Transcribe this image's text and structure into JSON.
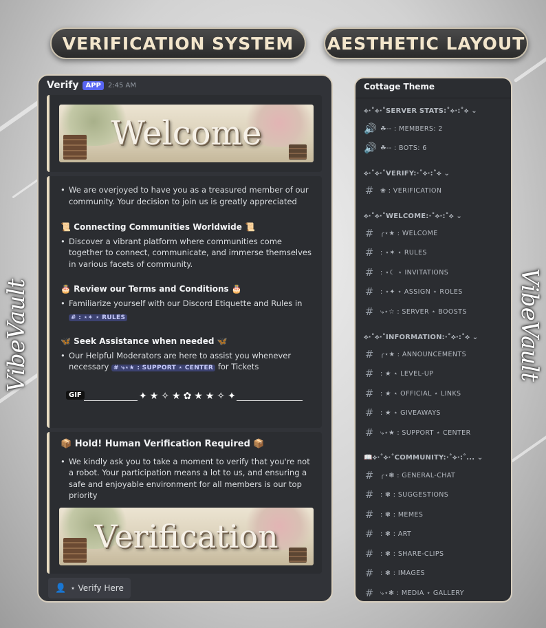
{
  "titles": {
    "left": "VERIFICATION SYSTEM",
    "right": "AESTHETIC LAYOUT"
  },
  "side_brand": "VibeVault",
  "message": {
    "author": "Verify",
    "badge": "APP",
    "time": "2:45 AM",
    "banner_welcome": "Welcome",
    "intro": "We are overjoyed to have you as a treasured member of our community. Your decision to join us is greatly appreciated",
    "sections": [
      {
        "heading": "Connecting Communities Worldwide",
        "text": "Discover a vibrant platform where communities come together to connect, communicate, and immerse themselves in various facets of community."
      },
      {
        "heading": "Review our Terms and Conditions",
        "text": "Familiarize yourself with our Discord Etiquette and Rules in"
      },
      {
        "heading": "Seek Assistance when needed",
        "text_before": "Our Helpful Moderators are here to assist you whenever necessary",
        "text_after": "for Tickets"
      }
    ],
    "mention_rules": "# : ⋆✶ ⋆ RULES",
    "mention_support": "# ⤷⋆★ : SUPPORT ⋆ CENTER",
    "gif_label": "GIF",
    "hold_heading": "Hold!  Human Verification Required",
    "hold_text": "We kindly ask you to take a moment to verify that you're not a robot. Your participation means a lot to us, and ensuring a safe and enjoyable environment for all members is our top priority",
    "banner_verification": "Verification",
    "button_label": "⋆ Verify Here"
  },
  "server": {
    "name": "Cottage Theme",
    "categories": [
      {
        "label": "⟡·˚⟡·˚SERVER STATS:˚⟡·:˚⟡ ⌄",
        "channels": [
          {
            "icon": "speaker-icon",
            "label": "☘︎-- : MEMBERS: 2"
          },
          {
            "icon": "speaker-icon",
            "label": "☘︎-- : BOTS: 6"
          }
        ]
      },
      {
        "label": "⟡·˚⟡·˚VERIFY:·˚⟡·:˚⟡ ⌄",
        "channels": [
          {
            "icon": "hash-icon",
            "label": "❀ : VERIFICATION"
          }
        ]
      },
      {
        "label": "⟡·˚⟡·˚WELCOME:·˚⟡·:˚⟡ ⌄",
        "channels": [
          {
            "icon": "hash-icon",
            "label": "╭⋆★ : WELCOME"
          },
          {
            "icon": "hash-icon",
            "label": ": ⋆✶ ⋆ RULES"
          },
          {
            "icon": "hash-icon",
            "label": ": ⋆☾ ⋆ INVITATIONS"
          },
          {
            "icon": "hash-icon",
            "label": ": ⋆✦ ⋆ ASSIGN ⋆ ROLES"
          },
          {
            "icon": "hash-icon",
            "label": "⤷⋆☆ : SERVER ⋆ BOOSTS"
          }
        ]
      },
      {
        "label": "⟡·˚⟡·˚INFORMATION:·˚⟡·:˚⟡ ⌄",
        "channels": [
          {
            "icon": "hash-icon",
            "label": "╭⋆★ : ANNOUNCEMENTS"
          },
          {
            "icon": "hash-icon",
            "label": ": ★ ⋆ LEVEL-UP"
          },
          {
            "icon": "hash-icon",
            "label": ": ★ ⋆ OFFICIAL ⋆ LINKS"
          },
          {
            "icon": "hash-icon",
            "label": ": ★ ⋆ GIVEAWAYS"
          },
          {
            "icon": "hash-icon",
            "label": "⤷⋆★ : SUPPORT ⋆ CENTER"
          }
        ]
      },
      {
        "label": "📖⟡·˚⟡·˚COMMUNITY:·˚⟡·:˚... ⌄",
        "channels": [
          {
            "icon": "hash-icon",
            "label": "╭⋆❃ : GENERAL-CHAT"
          },
          {
            "icon": "hash-icon",
            "label": ": ❃ : SUGGESTIONS"
          },
          {
            "icon": "hash-icon",
            "label": ": ❃ : MEMES"
          },
          {
            "icon": "hash-icon",
            "label": ": ❃ : ART"
          },
          {
            "icon": "hash-icon",
            "label": ": ❃ : SHARE-CLIPS"
          },
          {
            "icon": "hash-icon",
            "label": ": ❃ : IMAGES"
          },
          {
            "icon": "hash-icon",
            "label": "⤷⋆❃ : MEDIA ⋆ GALLERY"
          }
        ]
      }
    ]
  }
}
